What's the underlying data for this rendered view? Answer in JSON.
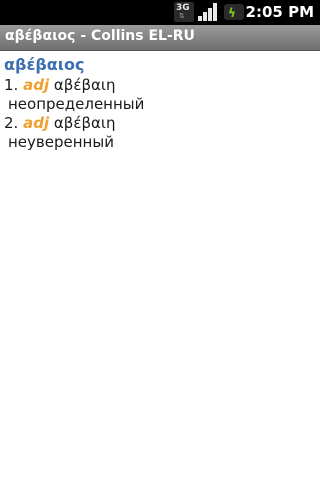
{
  "status_bar": {
    "network_label": "3G",
    "time": "2:05 PM"
  },
  "title_bar": {
    "title": "αβέβαιος - Collins EL-RU"
  },
  "entry": {
    "headword": "αβέβαιος",
    "senses": [
      {
        "number": "1.",
        "pos": "adj",
        "form": "αβέβαιη",
        "translation": "неопределенный"
      },
      {
        "number": "2.",
        "pos": "adj",
        "form": "αβέβαιη",
        "translation": "неуверенный"
      }
    ]
  },
  "colors": {
    "headword": "#3d6fb0",
    "pos": "#f0a030",
    "title_bar": "#808080",
    "status_bar": "#000000"
  }
}
